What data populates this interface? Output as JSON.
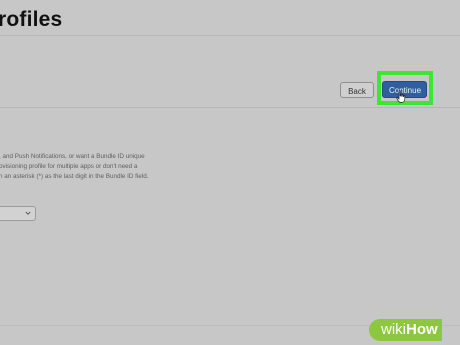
{
  "header": {
    "title": "rofiles"
  },
  "actions": {
    "back_label": "Back",
    "continue_label": "Continue"
  },
  "description": {
    "lines": [
      ", and Push Notifications, or want a Bundle ID unique",
      "ovisioning profile for multiple apps or don't need a",
      "n an asterisk (*) as the last digit in the Bundle ID field."
    ]
  },
  "select": {
    "value": ""
  },
  "watermark": {
    "part1": "wiki",
    "part2": "How"
  },
  "colors": {
    "background": "#c7c7c7",
    "primary_button": "#2f5f9e",
    "highlight": "#3de62f",
    "watermark": "#8dc63f"
  }
}
